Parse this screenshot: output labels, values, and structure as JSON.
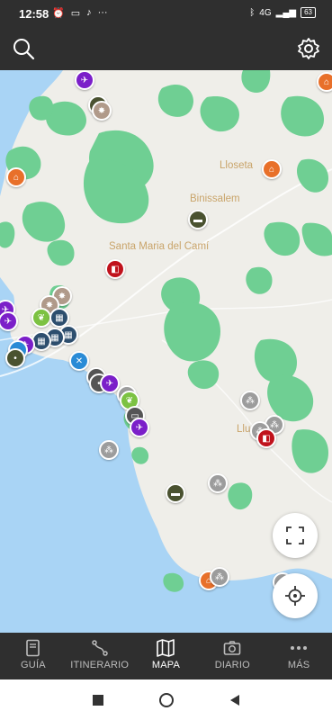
{
  "status_bar": {
    "time": "12:58",
    "left_icons": [
      "alarm-icon",
      "laptop-icon",
      "tiktok-icon",
      "more-dots-icon"
    ],
    "right_icons": [
      "bluetooth-icon",
      "signal-icon",
      "battery-icon"
    ],
    "network": "4G",
    "battery": "63"
  },
  "app_bar": {
    "left_icon": "search-icon",
    "right_icon": "gear-icon"
  },
  "map": {
    "towns": {
      "lloseta": "Lloseta",
      "binissalem": "Binissalem",
      "santa_maria": "Santa Maria del Camí",
      "llucmajor": "Llu"
    },
    "colors": {
      "land": "#efeee9",
      "sea": "#a9d4f5",
      "forest": "#6fcf93"
    }
  },
  "fabs": {
    "fullscreen": "fullscreen-icon",
    "locate": "locate-icon"
  },
  "bottom_nav": {
    "items": [
      {
        "label": "GUÍA",
        "icon": "book-icon"
      },
      {
        "label": "ITINERARIO",
        "icon": "route-icon"
      },
      {
        "label": "MAPA",
        "icon": "map-icon"
      },
      {
        "label": "DIARIO",
        "icon": "camera-icon"
      },
      {
        "label": "MÁS",
        "icon": "more-icon"
      }
    ],
    "active": "MAPA"
  }
}
